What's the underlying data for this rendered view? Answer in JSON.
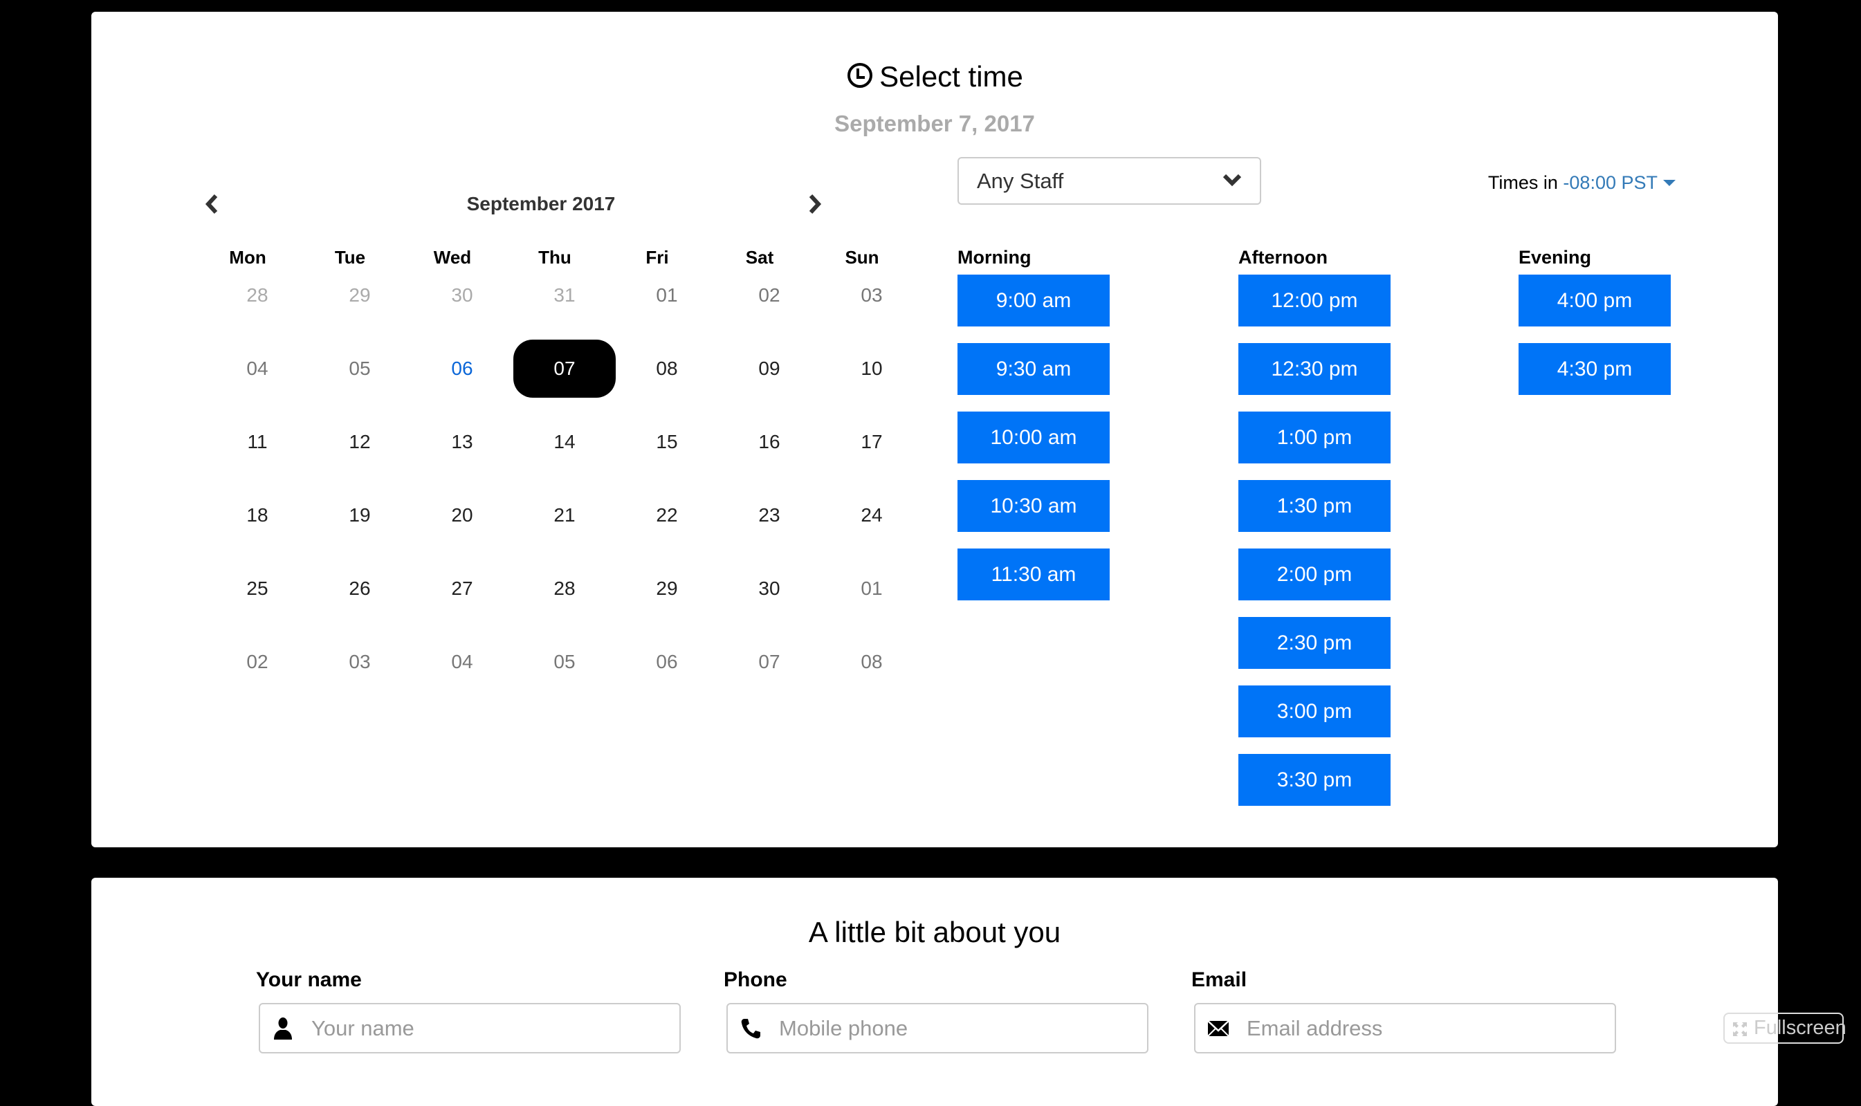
{
  "select_time": {
    "title": "Select time",
    "icon": "clock-icon",
    "date": "September 7, 2017"
  },
  "calendar": {
    "month_label": "September 2017",
    "prev_icon": "chevron-left-icon",
    "next_icon": "chevron-right-icon",
    "weekdays": [
      "Mon",
      "Tue",
      "Wed",
      "Thu",
      "Fri",
      "Sat",
      "Sun"
    ],
    "weeks": [
      [
        {
          "d": "28",
          "s": "prev-month"
        },
        {
          "d": "29",
          "s": "prev-month"
        },
        {
          "d": "30",
          "s": "prev-month"
        },
        {
          "d": "31",
          "s": "prev-month"
        },
        {
          "d": "01",
          "s": "past"
        },
        {
          "d": "02",
          "s": "past"
        },
        {
          "d": "03",
          "s": "past"
        }
      ],
      [
        {
          "d": "04",
          "s": "past"
        },
        {
          "d": "05",
          "s": "past"
        },
        {
          "d": "06",
          "s": "today"
        },
        {
          "d": "07",
          "s": "selected"
        },
        {
          "d": "08",
          "s": ""
        },
        {
          "d": "09",
          "s": ""
        },
        {
          "d": "10",
          "s": ""
        }
      ],
      [
        {
          "d": "11",
          "s": ""
        },
        {
          "d": "12",
          "s": ""
        },
        {
          "d": "13",
          "s": ""
        },
        {
          "d": "14",
          "s": ""
        },
        {
          "d": "15",
          "s": ""
        },
        {
          "d": "16",
          "s": ""
        },
        {
          "d": "17",
          "s": ""
        }
      ],
      [
        {
          "d": "18",
          "s": ""
        },
        {
          "d": "19",
          "s": ""
        },
        {
          "d": "20",
          "s": ""
        },
        {
          "d": "21",
          "s": ""
        },
        {
          "d": "22",
          "s": ""
        },
        {
          "d": "23",
          "s": ""
        },
        {
          "d": "24",
          "s": ""
        }
      ],
      [
        {
          "d": "25",
          "s": ""
        },
        {
          "d": "26",
          "s": ""
        },
        {
          "d": "27",
          "s": ""
        },
        {
          "d": "28",
          "s": ""
        },
        {
          "d": "29",
          "s": ""
        },
        {
          "d": "30",
          "s": ""
        },
        {
          "d": "01",
          "s": "next-month"
        }
      ],
      [
        {
          "d": "02",
          "s": "next-month"
        },
        {
          "d": "03",
          "s": "next-month"
        },
        {
          "d": "04",
          "s": "next-month"
        },
        {
          "d": "05",
          "s": "next-month"
        },
        {
          "d": "06",
          "s": "next-month"
        },
        {
          "d": "07",
          "s": "next-month"
        },
        {
          "d": "08",
          "s": "next-month"
        }
      ]
    ],
    "selected_day": "07",
    "today": "06"
  },
  "staff_select": {
    "value": "Any Staff",
    "icon": "chevron-down-icon"
  },
  "timezone": {
    "prefix": "Times in",
    "value": "-08:00 PST",
    "icon": "caret-down-icon"
  },
  "time_slots": {
    "columns": [
      {
        "heading": "Morning",
        "slots": [
          "9:00 am",
          "9:30 am",
          "10:00 am",
          "10:30 am",
          "11:30 am"
        ]
      },
      {
        "heading": "Afternoon",
        "slots": [
          "12:00 pm",
          "12:30 pm",
          "1:00 pm",
          "1:30 pm",
          "2:00 pm",
          "2:30 pm",
          "3:00 pm",
          "3:30 pm"
        ]
      },
      {
        "heading": "Evening",
        "slots": [
          "4:00 pm",
          "4:30 pm"
        ]
      }
    ]
  },
  "about_you": {
    "title": "A little bit about you",
    "fields": [
      {
        "label": "Your name",
        "placeholder": "Your name",
        "value": "",
        "icon": "user-icon"
      },
      {
        "label": "Phone",
        "placeholder": "Mobile phone",
        "value": "",
        "icon": "phone-icon"
      },
      {
        "label": "Email",
        "placeholder": "Email address",
        "value": "",
        "icon": "envelope-icon"
      }
    ]
  },
  "fullscreen_button": {
    "label": "Fullscreen",
    "icon": "expand-icon"
  },
  "colors": {
    "slot_button": "#0074f7",
    "timezone_link": "#337ab7",
    "today": "#0a66d8",
    "selected_day_bg": "#000000",
    "subtitle": "#aaaaaa"
  }
}
